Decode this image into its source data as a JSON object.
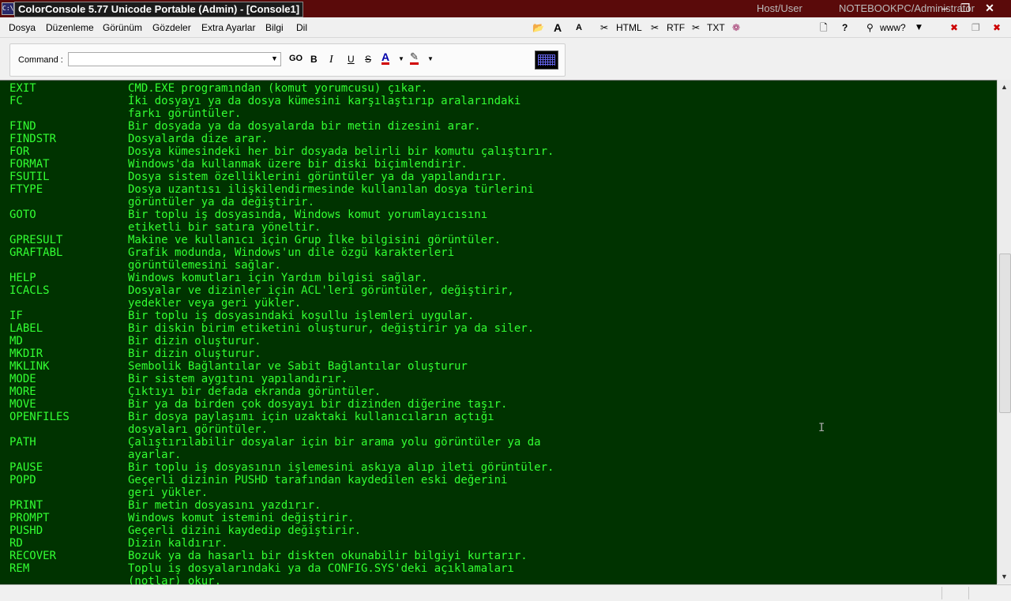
{
  "window": {
    "title": "ColorConsole 5.77 Unicode Portable (Admin) - [Console1]",
    "host_user_label": "Host/User",
    "machine_user": "NOTEBOOKPC/Administrator",
    "icon": "console-app-icon",
    "minimize": "–",
    "maximize": "❐",
    "close": "✕"
  },
  "menu": {
    "items": [
      "Dosya",
      "Düzenleme",
      "Görünüm",
      "Gözdeler",
      "Extra Ayarlar",
      "Bilgi",
      "Dil"
    ]
  },
  "toolbar": {
    "html_label": "HTML",
    "rtf_label": "RTF",
    "txt_label": "TXT",
    "help_label": "?",
    "www_label": "www?",
    "font_bigger": "A",
    "font_smaller": "A"
  },
  "command": {
    "label": "Command :",
    "value": "",
    "go_label": "GO",
    "bold_label": "B",
    "italic_label": "I",
    "underline_label": "U",
    "strike_label": "S",
    "color_label": "A"
  },
  "console": {
    "text_color": "#33ff33",
    "background_color": "#003300",
    "lines": [
      {
        "cmd": "EXIT",
        "desc": "CMD.EXE programından (komut yorumcusu) çıkar."
      },
      {
        "cmd": "FC",
        "desc": "İki dosyayı ya da dosya kümesini karşılaştırıp aralarındaki"
      },
      {
        "cmd": "",
        "desc": "farkı görüntüler."
      },
      {
        "cmd": "FIND",
        "desc": "Bir dosyada ya da dosyalarda bir metin dizesini arar."
      },
      {
        "cmd": "FINDSTR",
        "desc": "Dosyalarda dize arar."
      },
      {
        "cmd": "FOR",
        "desc": "Dosya kümesindeki her bir dosyada belirli bir komutu çalıştırır."
      },
      {
        "cmd": "FORMAT",
        "desc": "Windows'da kullanmak üzere bir diski biçimlendirir."
      },
      {
        "cmd": "FSUTIL",
        "desc": "Dosya sistem özelliklerini görüntüler ya da yapılandırır."
      },
      {
        "cmd": "FTYPE",
        "desc": "Dosya uzantısı ilişkilendirmesinde kullanılan dosya türlerini"
      },
      {
        "cmd": "",
        "desc": "görüntüler ya da değiştirir."
      },
      {
        "cmd": "GOTO",
        "desc": "Bir toplu iş dosyasında, Windows komut yorumlayıcısını"
      },
      {
        "cmd": "",
        "desc": "etiketli bir satıra yöneltir."
      },
      {
        "cmd": "GPRESULT",
        "desc": "Makine ve kullanıcı için Grup İlke bilgisini görüntüler."
      },
      {
        "cmd": "GRAFTABL",
        "desc": "Grafik modunda, Windows'un dile özgü karakterleri"
      },
      {
        "cmd": "",
        "desc": "görüntülemesini sağlar."
      },
      {
        "cmd": "HELP",
        "desc": "Windows komutları için Yardım bilgisi sağlar."
      },
      {
        "cmd": "ICACLS",
        "desc": "Dosyalar ve dizinler için ACL'leri görüntüler, değiştirir,"
      },
      {
        "cmd": "",
        "desc": "yedekler veya geri yükler."
      },
      {
        "cmd": "IF",
        "desc": "Bir toplu iş dosyasındaki koşullu işlemleri uygular."
      },
      {
        "cmd": "LABEL",
        "desc": "Bir diskin birim etiketini oluşturur, değiştirir ya da siler."
      },
      {
        "cmd": "MD",
        "desc": "Bir dizin oluşturur."
      },
      {
        "cmd": "MKDIR",
        "desc": "Bir dizin oluşturur."
      },
      {
        "cmd": "MKLINK",
        "desc": "Sembolik Bağlantılar ve Sabit Bağlantılar oluşturur"
      },
      {
        "cmd": "MODE",
        "desc": "Bir sistem aygıtını yapılandırır."
      },
      {
        "cmd": "MORE",
        "desc": "Çıktıyı bir defada ekranda görüntüler."
      },
      {
        "cmd": "MOVE",
        "desc": "Bir ya da birden çok dosyayı bir dizinden diğerine taşır."
      },
      {
        "cmd": "OPENFILES",
        "desc": "Bir dosya paylaşımı için uzaktaki kullanıcıların açtığı"
      },
      {
        "cmd": "",
        "desc": "dosyaları görüntüler."
      },
      {
        "cmd": "PATH",
        "desc": "Çalıştırılabilir dosyalar için bir arama yolu görüntüler ya da"
      },
      {
        "cmd": "",
        "desc": "ayarlar."
      },
      {
        "cmd": "PAUSE",
        "desc": "Bir toplu iş dosyasının işlemesini askıya alıp ileti görüntüler."
      },
      {
        "cmd": "POPD",
        "desc": "Geçerli dizinin PUSHD tarafından kaydedilen eski değerini"
      },
      {
        "cmd": "",
        "desc": "geri yükler."
      },
      {
        "cmd": "PRINT",
        "desc": "Bir metin dosyasını yazdırır."
      },
      {
        "cmd": "PROMPT",
        "desc": "Windows komut istemini değiştirir."
      },
      {
        "cmd": "PUSHD",
        "desc": "Geçerli dizini kaydedip değiştirir."
      },
      {
        "cmd": "RD",
        "desc": "Dizin kaldırır."
      },
      {
        "cmd": "RECOVER",
        "desc": "Bozuk ya da hasarlı bir diskten okunabilir bilgiyi kurtarır."
      },
      {
        "cmd": "REM",
        "desc": "Toplu iş dosyalarındaki ya da CONFIG.SYS'deki açıklamaları"
      },
      {
        "cmd": "",
        "desc": "(notlar) okur."
      }
    ]
  }
}
